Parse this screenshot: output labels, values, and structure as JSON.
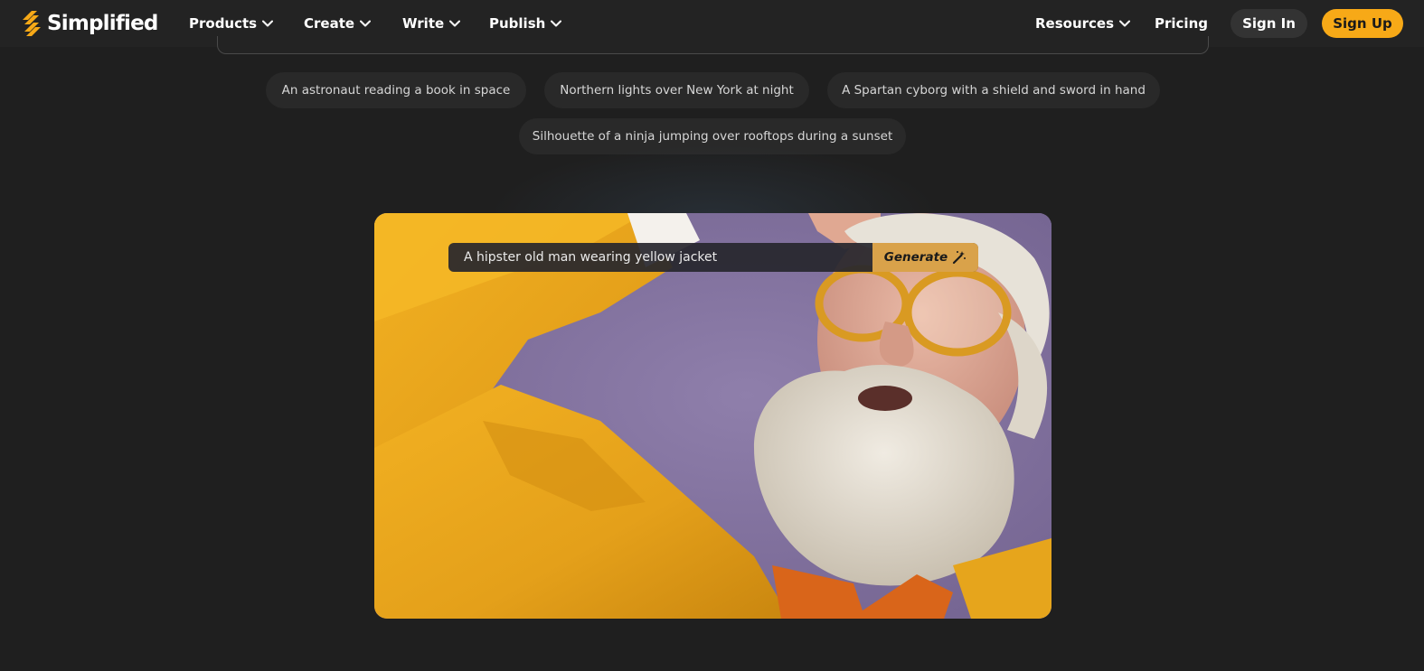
{
  "brand": {
    "name": "Simplified",
    "logo_icon": "simplified-logo-icon",
    "accent": "#f7a917"
  },
  "nav": {
    "menus": [
      {
        "label": "Products",
        "icon": "chevron-down-icon"
      },
      {
        "label": "Create",
        "icon": "chevron-down-icon"
      },
      {
        "label": "Write",
        "icon": "chevron-down-icon"
      },
      {
        "label": "Publish",
        "icon": "chevron-down-icon"
      }
    ],
    "resources": {
      "label": "Resources",
      "icon": "chevron-down-icon"
    },
    "pricing": "Pricing",
    "sign_in": "Sign In",
    "sign_up": "Sign Up"
  },
  "suggestions": [
    "An astronaut reading a book in space",
    "Northern lights over New York at night",
    "A Spartan cyborg with a shield and sword in hand",
    "Silhouette of a ninja jumping over rooftops during a sunset"
  ],
  "demo": {
    "prompt_value": "A hipster old man wearing yellow jacket",
    "generate_label": "Generate",
    "generate_icon": "magic-wand-icon",
    "image_subject": "hipster-old-man-yellow-jacket"
  },
  "colors": {
    "background": "#1f1f1f",
    "navbar": "#232323",
    "chip_bg": "#292929",
    "generate_bg": "#d9a24a"
  }
}
